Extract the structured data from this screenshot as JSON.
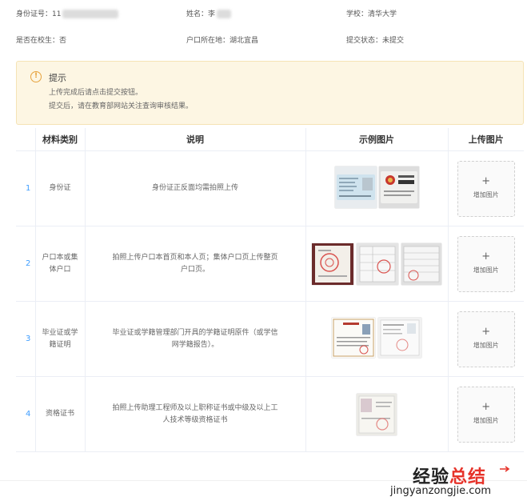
{
  "student_info": {
    "id_label": "身份证号：11",
    "name_label": "姓名：李",
    "school": "学校：清华大学",
    "in_school": "是否在校生：否",
    "hukou": "户口所在地：湖北宜昌",
    "submit_status": "提交状态：未提交"
  },
  "notice": {
    "icon": "warning-icon",
    "title": "提示",
    "line1": "上传完成后请点击提交按钮。",
    "line2": "提交后，请在教育部网站关注查询审核结果。"
  },
  "table": {
    "headers": {
      "category": "材料类别",
      "description": "说明",
      "sample": "示例图片",
      "upload": "上传图片"
    },
    "rows": [
      {
        "index": "1",
        "category": "身份证",
        "description": "身份证正反面均需拍照上传",
        "upload_label": "增加图片"
      },
      {
        "index": "2",
        "category": "户口本或集体户口",
        "description": "拍照上传户口本首页和本人页；集体户口页上传整页户口页。",
        "upload_label": "增加图片"
      },
      {
        "index": "3",
        "category": "毕业证或学籍证明",
        "description": "毕业证或学籍管理部门开具的学籍证明原件（或学信网学籍报告）。",
        "upload_label": "增加图片"
      },
      {
        "index": "4",
        "category": "资格证书",
        "description": "拍照上传助理工程师及以上职称证书或中级及以上工人技术等级资格证书",
        "upload_label": "增加图片"
      }
    ]
  },
  "watermark": {
    "brand_part1": "经验",
    "brand_part2": "总结",
    "url": "jingyanzongjie.com"
  },
  "colors": {
    "accent": "#409eff",
    "notice_bg": "#fdf6e3",
    "notice_icon": "#e6a23c",
    "watermark_red": "#e6332a"
  }
}
